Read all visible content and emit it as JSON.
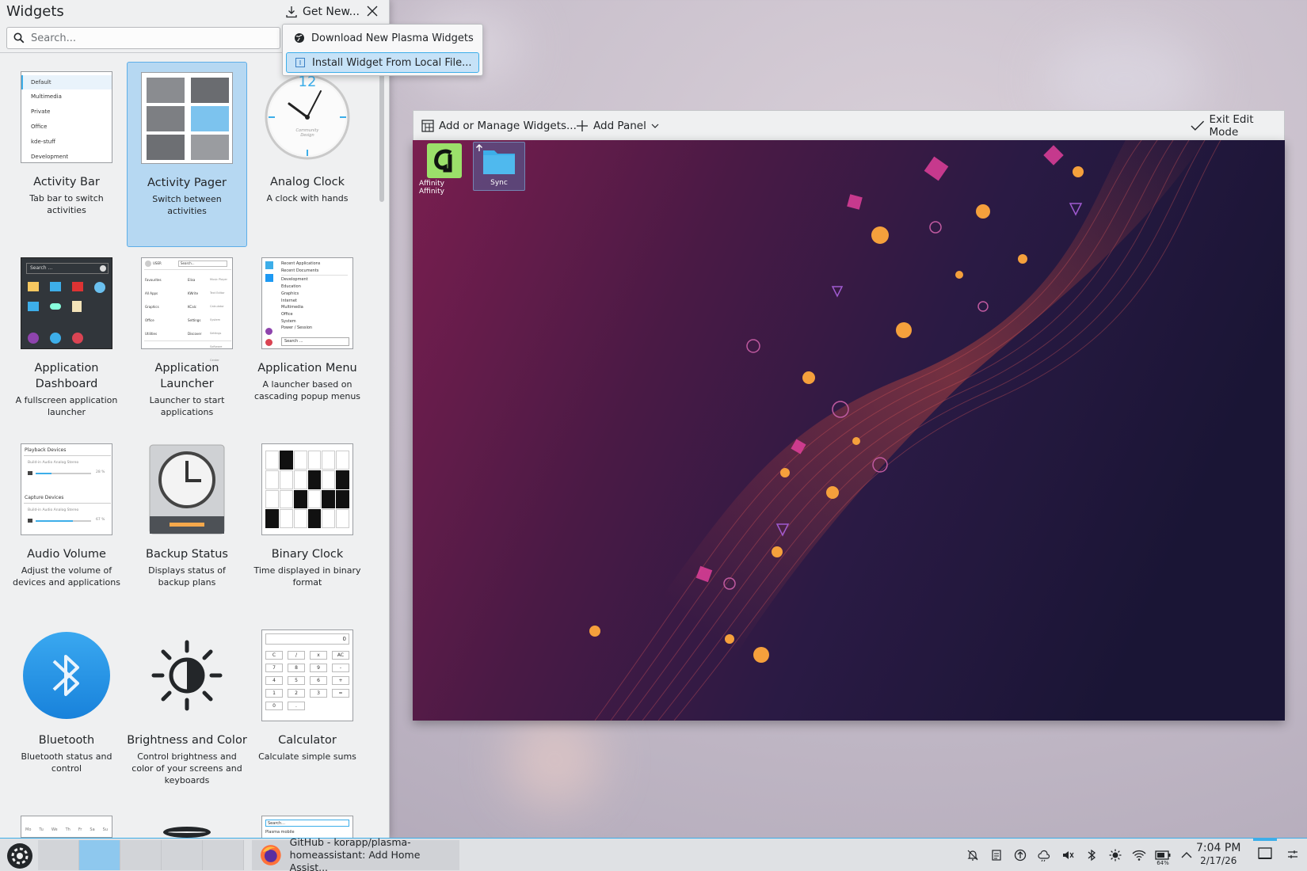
{
  "widgets_panel": {
    "title": "Widgets",
    "get_new_label": "Get New...",
    "search_placeholder": "Search...",
    "tiles": [
      {
        "name": "Activity Bar",
        "desc": "Tab bar to switch activities",
        "thumb": "activity-bar"
      },
      {
        "name": "Activity Pager",
        "desc": "Switch between activities",
        "thumb": "activity-pager"
      },
      {
        "name": "Analog Clock",
        "desc": "A clock with hands",
        "thumb": "analog-clock"
      },
      {
        "name": "Application Dashboard",
        "desc": "A fullscreen application launcher",
        "thumb": "app-dashboard"
      },
      {
        "name": "Application Launcher",
        "desc": "Launcher to start applications",
        "thumb": "app-launcher"
      },
      {
        "name": "Application Menu",
        "desc": "A launcher based on cascading popup menus",
        "thumb": "app-menu"
      },
      {
        "name": "Audio Volume",
        "desc": "Adjust the volume of devices and applications",
        "thumb": "audio-volume"
      },
      {
        "name": "Backup Status",
        "desc": "Displays status of backup plans",
        "thumb": "backup-status"
      },
      {
        "name": "Binary Clock",
        "desc": "Time displayed in binary format",
        "thumb": "binary-clock"
      },
      {
        "name": "Bluetooth",
        "desc": "Bluetooth status and control",
        "thumb": "bluetooth"
      },
      {
        "name": "Brightness and Color",
        "desc": "Control brightness and color of your screens and keyboards",
        "thumb": "brightness"
      },
      {
        "name": "Calculator",
        "desc": "Calculate simple sums",
        "thumb": "calculator"
      }
    ],
    "thumb_text": {
      "activity_bar": [
        "Default",
        "Multimedia",
        "Private",
        "Office",
        "kde-stuff",
        "Development"
      ],
      "clock_number": "12",
      "clock_brand": "Community Design",
      "dashboard_search": "Search ...",
      "launcher_user": "USER",
      "launcher_search": "Search...",
      "launcher_left": [
        "Favourites",
        "All Apps",
        "Graphics",
        "Office",
        "Utilities"
      ],
      "launcher_right": [
        "Elisa",
        "KWrite",
        "KCalc",
        "Settings",
        "Discover"
      ],
      "launcher_right_sub": [
        "Music Player",
        "Text Editor",
        "Calculator",
        "System Settings",
        "Software Center"
      ],
      "app_menu": [
        "Recent Applications",
        "Recent Documents",
        "Development",
        "Education",
        "Graphics",
        "Internet",
        "Multimedia",
        "Office",
        "System",
        "Power / Session"
      ],
      "app_menu_search": "Search ...",
      "audio_playback": "Playback Devices",
      "audio_capture": "Capture Devices",
      "audio_device": "Build-in Audio Analog Stereo",
      "audio_pct1": "28 %",
      "audio_pct2": "67 %",
      "calc_display": "0",
      "calc_keys": [
        "C",
        "/",
        "x",
        "AC",
        "7",
        "8",
        "9",
        "-",
        "4",
        "5",
        "6",
        "+",
        "1",
        "2",
        "3",
        "=",
        "0",
        "."
      ],
      "partial_calendar": [
        "Mo",
        "Tu",
        "We",
        "Th",
        "Fr",
        "Sa",
        "Su"
      ],
      "partial_search": "Search...",
      "partial_plasma": "Plasma mobile"
    }
  },
  "getnew_menu": {
    "items": [
      {
        "label": "Download New Plasma Widgets",
        "icon": "globe-icon"
      },
      {
        "label": "Install Widget From Local File...",
        "icon": "file-icon"
      }
    ]
  },
  "edit_toolbar": {
    "add_manage_label": "Add or Manage Widgets...",
    "add_panel_label": "Add Panel",
    "exit_label": "Exit Edit Mode"
  },
  "desktop": {
    "icons": [
      {
        "label": "Affinity Affinity"
      },
      {
        "label": "Sync"
      }
    ]
  },
  "taskbar": {
    "task_title_line1": "GitHub - korapp/plasma-",
    "task_title_line2": "homeassistant: Add Home Assist...",
    "battery_pct": "64%",
    "time": "7:04 PM",
    "date": "2/17/26"
  },
  "colors": {
    "accent": "#3daee9",
    "panel_bg": "#eff0f1"
  }
}
